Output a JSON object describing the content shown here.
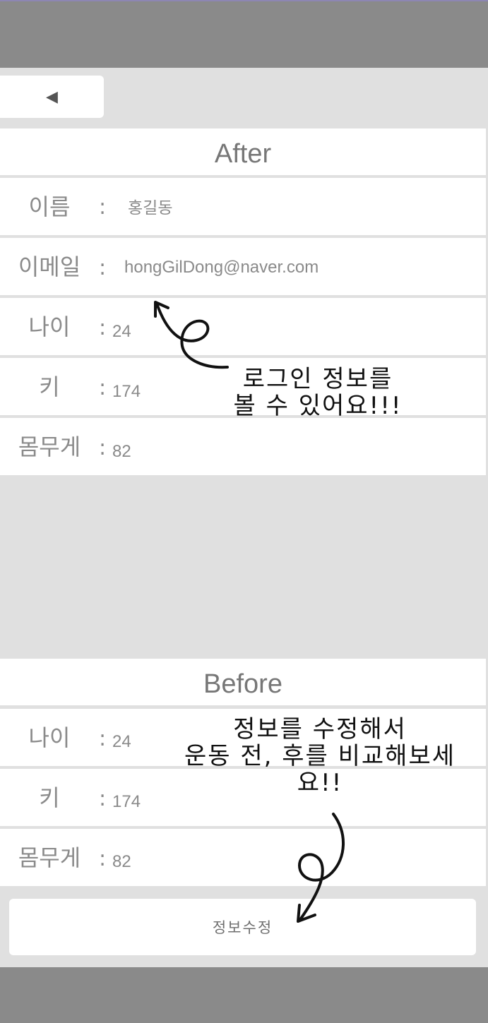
{
  "nav": {
    "back_icon": "◀"
  },
  "after": {
    "title": "After",
    "rows": [
      {
        "label": "이름",
        "colon": ":",
        "value": "홍길동"
      },
      {
        "label": "이메일",
        "colon": ":",
        "value": "hongGilDong@naver.com"
      },
      {
        "label": "나이",
        "colon": ":",
        "value": "24"
      },
      {
        "label": "키",
        "colon": ":",
        "value": "174"
      },
      {
        "label": "몸무게",
        "colon": ":",
        "value": "82"
      }
    ]
  },
  "before": {
    "title": "Before",
    "rows": [
      {
        "label": "나이",
        "colon": ":",
        "value": "24"
      },
      {
        "label": "키",
        "colon": ":",
        "value": "174"
      },
      {
        "label": "몸무게",
        "colon": ":",
        "value": "82"
      }
    ]
  },
  "actions": {
    "edit_label": "정보수정"
  },
  "annotations": {
    "login_info": {
      "line1": "로그인 정보를",
      "line2": "볼 수 있어요!!!"
    },
    "edit_info": {
      "line1": "정보를 수정해서",
      "line2": "운동 전, 후를 비교해보세",
      "line3": "요!!"
    }
  },
  "colors": {
    "topbar": "#8a8a8a",
    "page_bg": "#e0e0e0",
    "card": "#ffffff",
    "text_gray": "#8a8a8a"
  }
}
